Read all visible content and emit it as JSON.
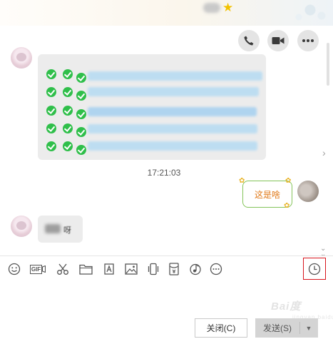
{
  "title_bar": {
    "icon": "star-icon"
  },
  "call_buttons": [
    {
      "icon": "phone-icon"
    },
    {
      "icon": "video-camera-icon"
    },
    {
      "icon": "more-icon"
    }
  ],
  "messages": {
    "timestamp": "17:21:03",
    "sent_text": "这是啥",
    "received_short_text": "呀"
  },
  "toolbar": {
    "items": [
      {
        "icon": "emoji-icon"
      },
      {
        "icon": "gif-icon",
        "label": "GIF"
      },
      {
        "icon": "scissors-icon"
      },
      {
        "icon": "folder-icon"
      },
      {
        "icon": "font-style-icon"
      },
      {
        "icon": "image-icon"
      },
      {
        "icon": "shake-icon"
      },
      {
        "icon": "red-envelope-icon"
      },
      {
        "icon": "music-icon"
      },
      {
        "icon": "more-options-icon"
      },
      {
        "icon": "clock-history-icon"
      }
    ]
  },
  "buttons": {
    "close_label": "关闭(C)",
    "send_label": "发送(S)"
  },
  "watermark": {
    "text": "Bai度",
    "sub": "jingyan.baidu.com"
  },
  "colors": {
    "accent_green": "#2fbf4a",
    "highlight_red": "#d8141c",
    "sent_text_color": "#e07a1a",
    "bubble_border": "#84c45a"
  }
}
